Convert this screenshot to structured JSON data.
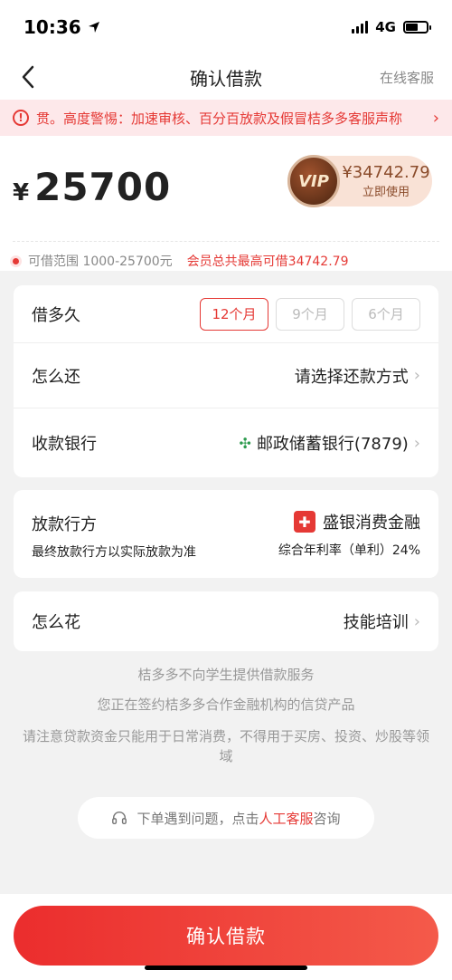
{
  "status": {
    "time": "10:36",
    "network": "4G"
  },
  "nav": {
    "title": "确认借款",
    "right_link": "在线客服"
  },
  "warning": {
    "text": "贯。高度警惕：加速审核、百分百放款及假冒桔多多客服声称"
  },
  "amount": {
    "currency": "¥",
    "value": "25700"
  },
  "vip": {
    "badge": "VIP",
    "amount": "¥34742.79",
    "action": "立即使用"
  },
  "range": {
    "text": "可借范围 1000-25700元",
    "vip_text": "会员总共最高可借34742.79"
  },
  "loan_card": {
    "duration_label": "借多久",
    "periods": [
      {
        "label": "12个月",
        "selected": true
      },
      {
        "label": "9个月",
        "selected": false
      },
      {
        "label": "6个月",
        "selected": false
      }
    ],
    "repay_label": "怎么还",
    "repay_value": "请选择还款方式",
    "bank_label": "收款银行",
    "bank_value": "邮政储蓄银行(7879)"
  },
  "lender_card": {
    "label": "放款行方",
    "sublabel": "最终放款行方以实际放款为准",
    "lender_name": "盛银消费金融",
    "rate_text": "综合年利率（单利）24%"
  },
  "usage_card": {
    "label": "怎么花",
    "value": "技能培训"
  },
  "notes": {
    "line1": "桔多多不向学生提供借款服务",
    "line2": "您正在签约桔多多合作金融机构的信贷产品",
    "line3": "请注意贷款资金只能用于日常消费，不得用于买房、投资、炒股等领域"
  },
  "help": {
    "prefix": "下单遇到问题，点击",
    "link": "人工客服",
    "suffix": "咨询"
  },
  "confirm": {
    "label": "确认借款"
  },
  "colors": {
    "accent": "#e53935",
    "vip_brown": "#8a4b2a",
    "bank_green": "#2e9b4f"
  }
}
